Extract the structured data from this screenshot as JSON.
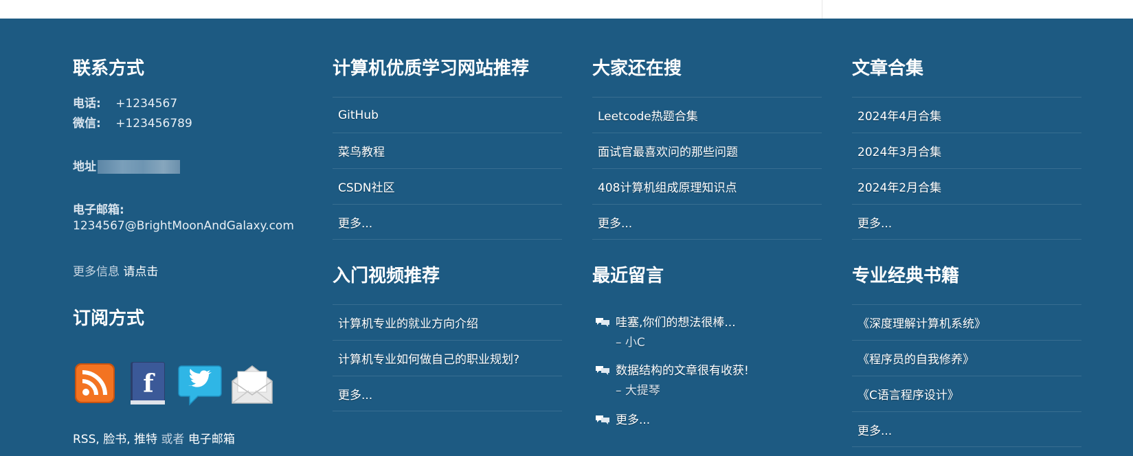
{
  "contact": {
    "title": "联系方式",
    "phone_label": "电话:",
    "phone_value": "+1234567",
    "wechat_label": "微信:",
    "wechat_value": "+123456789",
    "address_label": "地址",
    "email_label": "电子邮箱:",
    "email_value": "1234567@BrightMoonAndGalaxy.com",
    "more_info_prefix": "更多信息",
    "more_info_link": "请点击"
  },
  "subscribe": {
    "title": "订阅方式",
    "icons": [
      "rss-icon",
      "facebook-icon",
      "twitter-icon",
      "email-icon"
    ],
    "rss": "RSS",
    "facebook": "脸书",
    "twitter": "推特",
    "or": "或者",
    "email": "电子邮箱"
  },
  "learning_sites": {
    "title": "计算机优质学习网站推荐",
    "items": [
      "GitHub",
      "菜鸟教程",
      "CSDN社区",
      "更多..."
    ]
  },
  "intro_videos": {
    "title": "入门视频推荐",
    "items": [
      "计算机专业的就业方向介绍",
      "计算机专业如何做自己的职业规划?",
      "更多..."
    ]
  },
  "searches": {
    "title": "大家还在搜",
    "items": [
      "Leetcode热题合集",
      "面试官最喜欢问的那些问题",
      "408计算机组成原理知识点",
      "更多..."
    ]
  },
  "recent_comments": {
    "title": "最近留言",
    "items": [
      {
        "text": "哇塞,你们的想法很棒...",
        "author": "– 小C"
      },
      {
        "text": "数据结构的文章很有收获!",
        "author": "– 大提琴"
      },
      {
        "text": "更多...",
        "author": ""
      }
    ]
  },
  "articles": {
    "title": "文章合集",
    "items": [
      "2024年4月合集",
      "2024年3月合集",
      "2024年2月合集",
      "更多..."
    ]
  },
  "books": {
    "title": "专业经典书籍",
    "items": [
      "《深度理解计算机系统》",
      "《程序员的自我修养》",
      "《C语言程序设计》",
      "更多..."
    ]
  },
  "colors": {
    "footer_bg": "#1d5a82",
    "text": "#ffffff"
  }
}
